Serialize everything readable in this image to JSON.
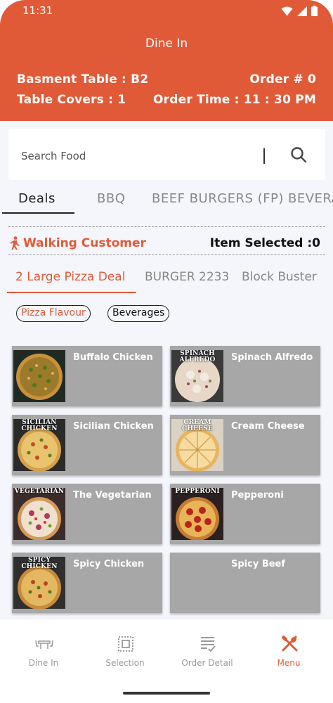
{
  "status_bar": {
    "time": "11:31",
    "icons": [
      "wifi-icon",
      "signal-icon",
      "battery-icon"
    ]
  },
  "header": {
    "title": "Dine In",
    "table_label": "Basment Table : B2",
    "order_label": "Order # 0",
    "covers_label": "Table Covers : 1",
    "order_time_label": "Order Time : 11 : 30 PM"
  },
  "search": {
    "placeholder": "Search Food"
  },
  "category_tabs": [
    {
      "label": "Deals",
      "active": true
    },
    {
      "label": "BBQ"
    },
    {
      "label": "BEEF BURGERS (FP)"
    },
    {
      "label": "BEVERAGES"
    }
  ],
  "customer": {
    "name": "Walking Customer",
    "selected": "Item Selected :0"
  },
  "deal_tabs": [
    {
      "label": "2 Large Pizza Deal",
      "active": true
    },
    {
      "label": "BURGER 2233"
    },
    {
      "label": "Block Buster"
    }
  ],
  "chips": [
    {
      "label": "Pizza Flavour",
      "active": true
    },
    {
      "label": "Beverages"
    }
  ],
  "items": [
    {
      "name": "Buffalo Chicken",
      "caption": ""
    },
    {
      "name": "Spinach Alfredo",
      "caption": "SPINACH ALFREDO"
    },
    {
      "name": "Sicilian Chicken",
      "caption": "SICILIAN CHICKEN"
    },
    {
      "name": "Cream Cheese",
      "caption": "CREAM CHEESE"
    },
    {
      "name": "The Vegetarian",
      "caption": "VEGETARIAN"
    },
    {
      "name": "Pepperoni",
      "caption": "PEPPERONI"
    },
    {
      "name": "Spicy Chicken",
      "caption": "SPICY CHICKEN"
    },
    {
      "name": "Spicy Beef",
      "caption": ""
    }
  ],
  "bottom_nav": [
    {
      "label": "Dine In",
      "icon": "table-icon"
    },
    {
      "label": "Selection",
      "icon": "selection-icon"
    },
    {
      "label": "Order Detail",
      "icon": "order-list-icon"
    },
    {
      "label": "Menu",
      "icon": "fork-knife-icon",
      "active": true
    }
  ],
  "colors": {
    "primary": "#e15a38",
    "card": "#a7a7a7"
  }
}
